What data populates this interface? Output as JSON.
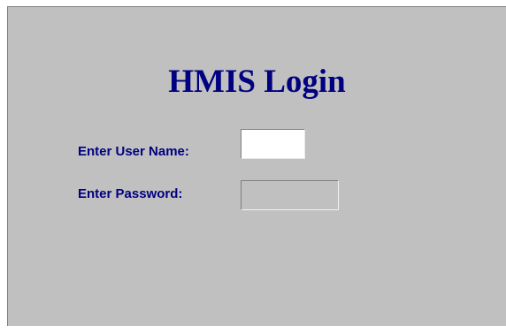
{
  "login": {
    "title": "HMIS Login",
    "username_label": "Enter User Name:",
    "username_value": "",
    "password_label": "Enter Password:",
    "password_value": ""
  },
  "colors": {
    "background": "#c0c0c0",
    "text": "#000080",
    "input_active": "#ffffff",
    "input_inactive": "#c0c0c0"
  }
}
